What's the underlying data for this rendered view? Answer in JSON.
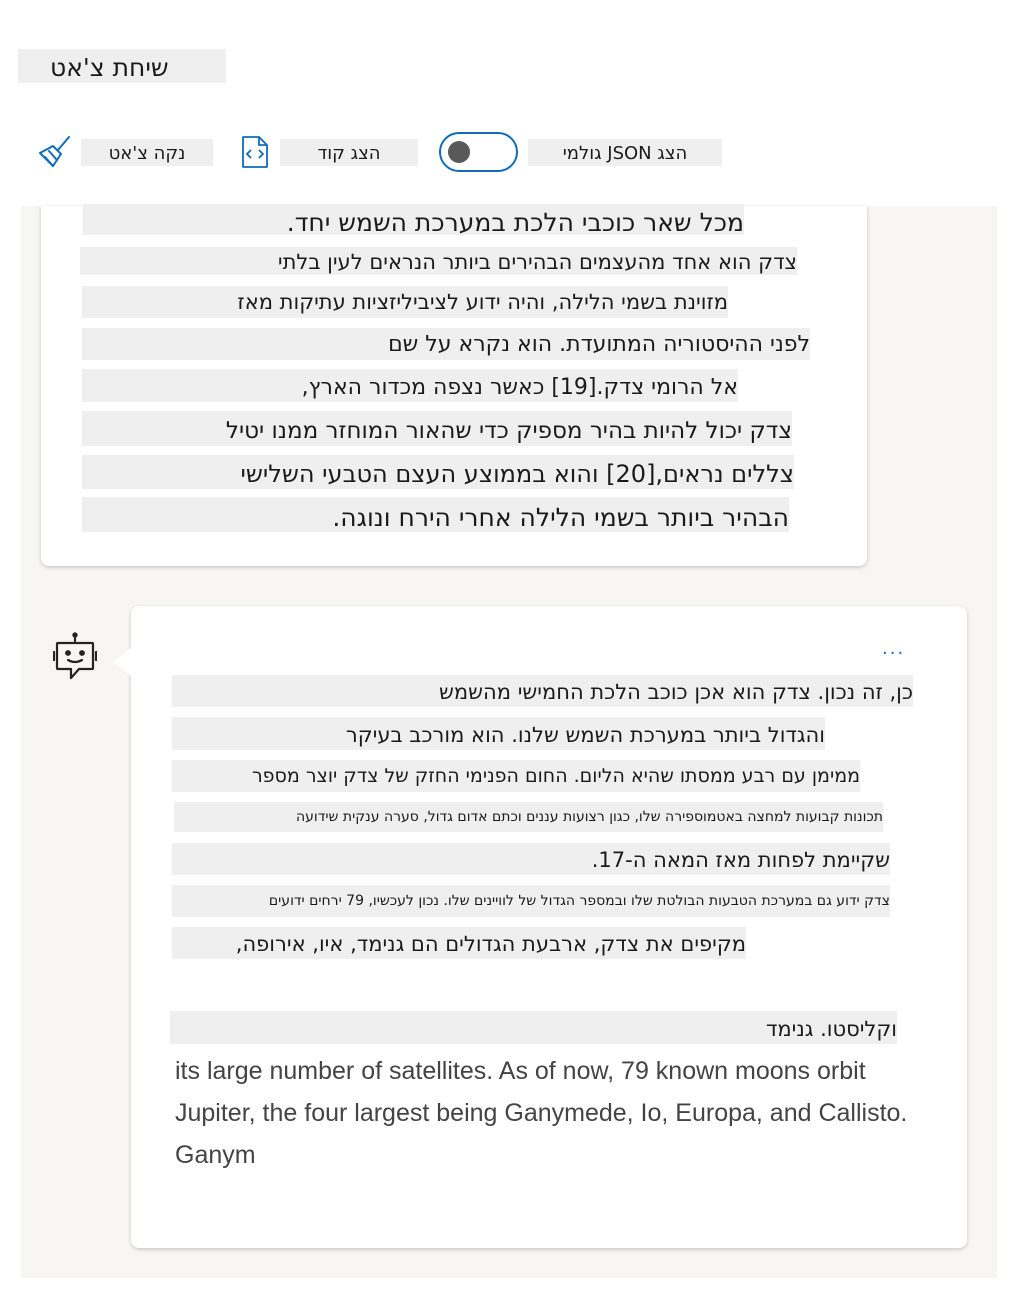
{
  "header": {
    "title": "שיחת צ'אט"
  },
  "toolbar": {
    "clear_label": "נקה צ'אט",
    "show_code_label": "הצג קוד",
    "raw_json_label": "הצג JSON גולמי",
    "raw_json_toggle_on": false
  },
  "user_message": {
    "lines": [
      "מכל שאר כוכבי הלכת במערכת השמש יחד.",
      "צדק הוא אחד מהעצמים הבהירים ביותר הנראים לעין בלתי",
      "מזוינת בשמי הלילה, והיה ידוע לציביליזציות עתיקות מאז",
      "לפני ההיסטוריה המתועדת. הוא נקרא על שם",
      "אל הרומי צדק.[19] כאשר נצפה מכדור הארץ,",
      "צדק יכול להיות בהיר מספיק כדי שהאור המוחזר ממנו יטיל",
      "צללים נראים,[20] והוא בממוצע העצם הטבעי השלישי",
      "הבהיר ביותר בשמי הלילה אחרי הירח ונוגה."
    ]
  },
  "bot_message": {
    "more_label": "...",
    "lines": [
      "כן, זה נכון. צדק הוא אכן כוכב הלכת החמישי מהשמש",
      "והגדול ביותר במערכת השמש שלנו. הוא מורכב בעיקר",
      "ממימן עם רבע ממסתו שהיא הליום. החום הפנימי החזק של צדק יוצר מספר",
      "תכונות קבועות למחצה באטמוספירה שלו, כגון רצועות עננים וכתם אדום גדול, סערה ענקית שידועה",
      "שקיימת לפחות מאז המאה ה-17.",
      "צדק ידוע גם במערכת הטבעות הבולטת שלו ובמספר הגדול של לוויינים שלו. נכון לעכשיו, 79 ירחים ידועים",
      "מקיפים את צדק, ארבעת הגדולים הם גנימד, איו, אירופה,",
      "וקליסטו. גנימד"
    ],
    "english_text": "its large number of satellites. As of now, 79 known moons orbit Jupiter, the four largest being Ganymede, Io, Europa, and Callisto. Ganym"
  }
}
